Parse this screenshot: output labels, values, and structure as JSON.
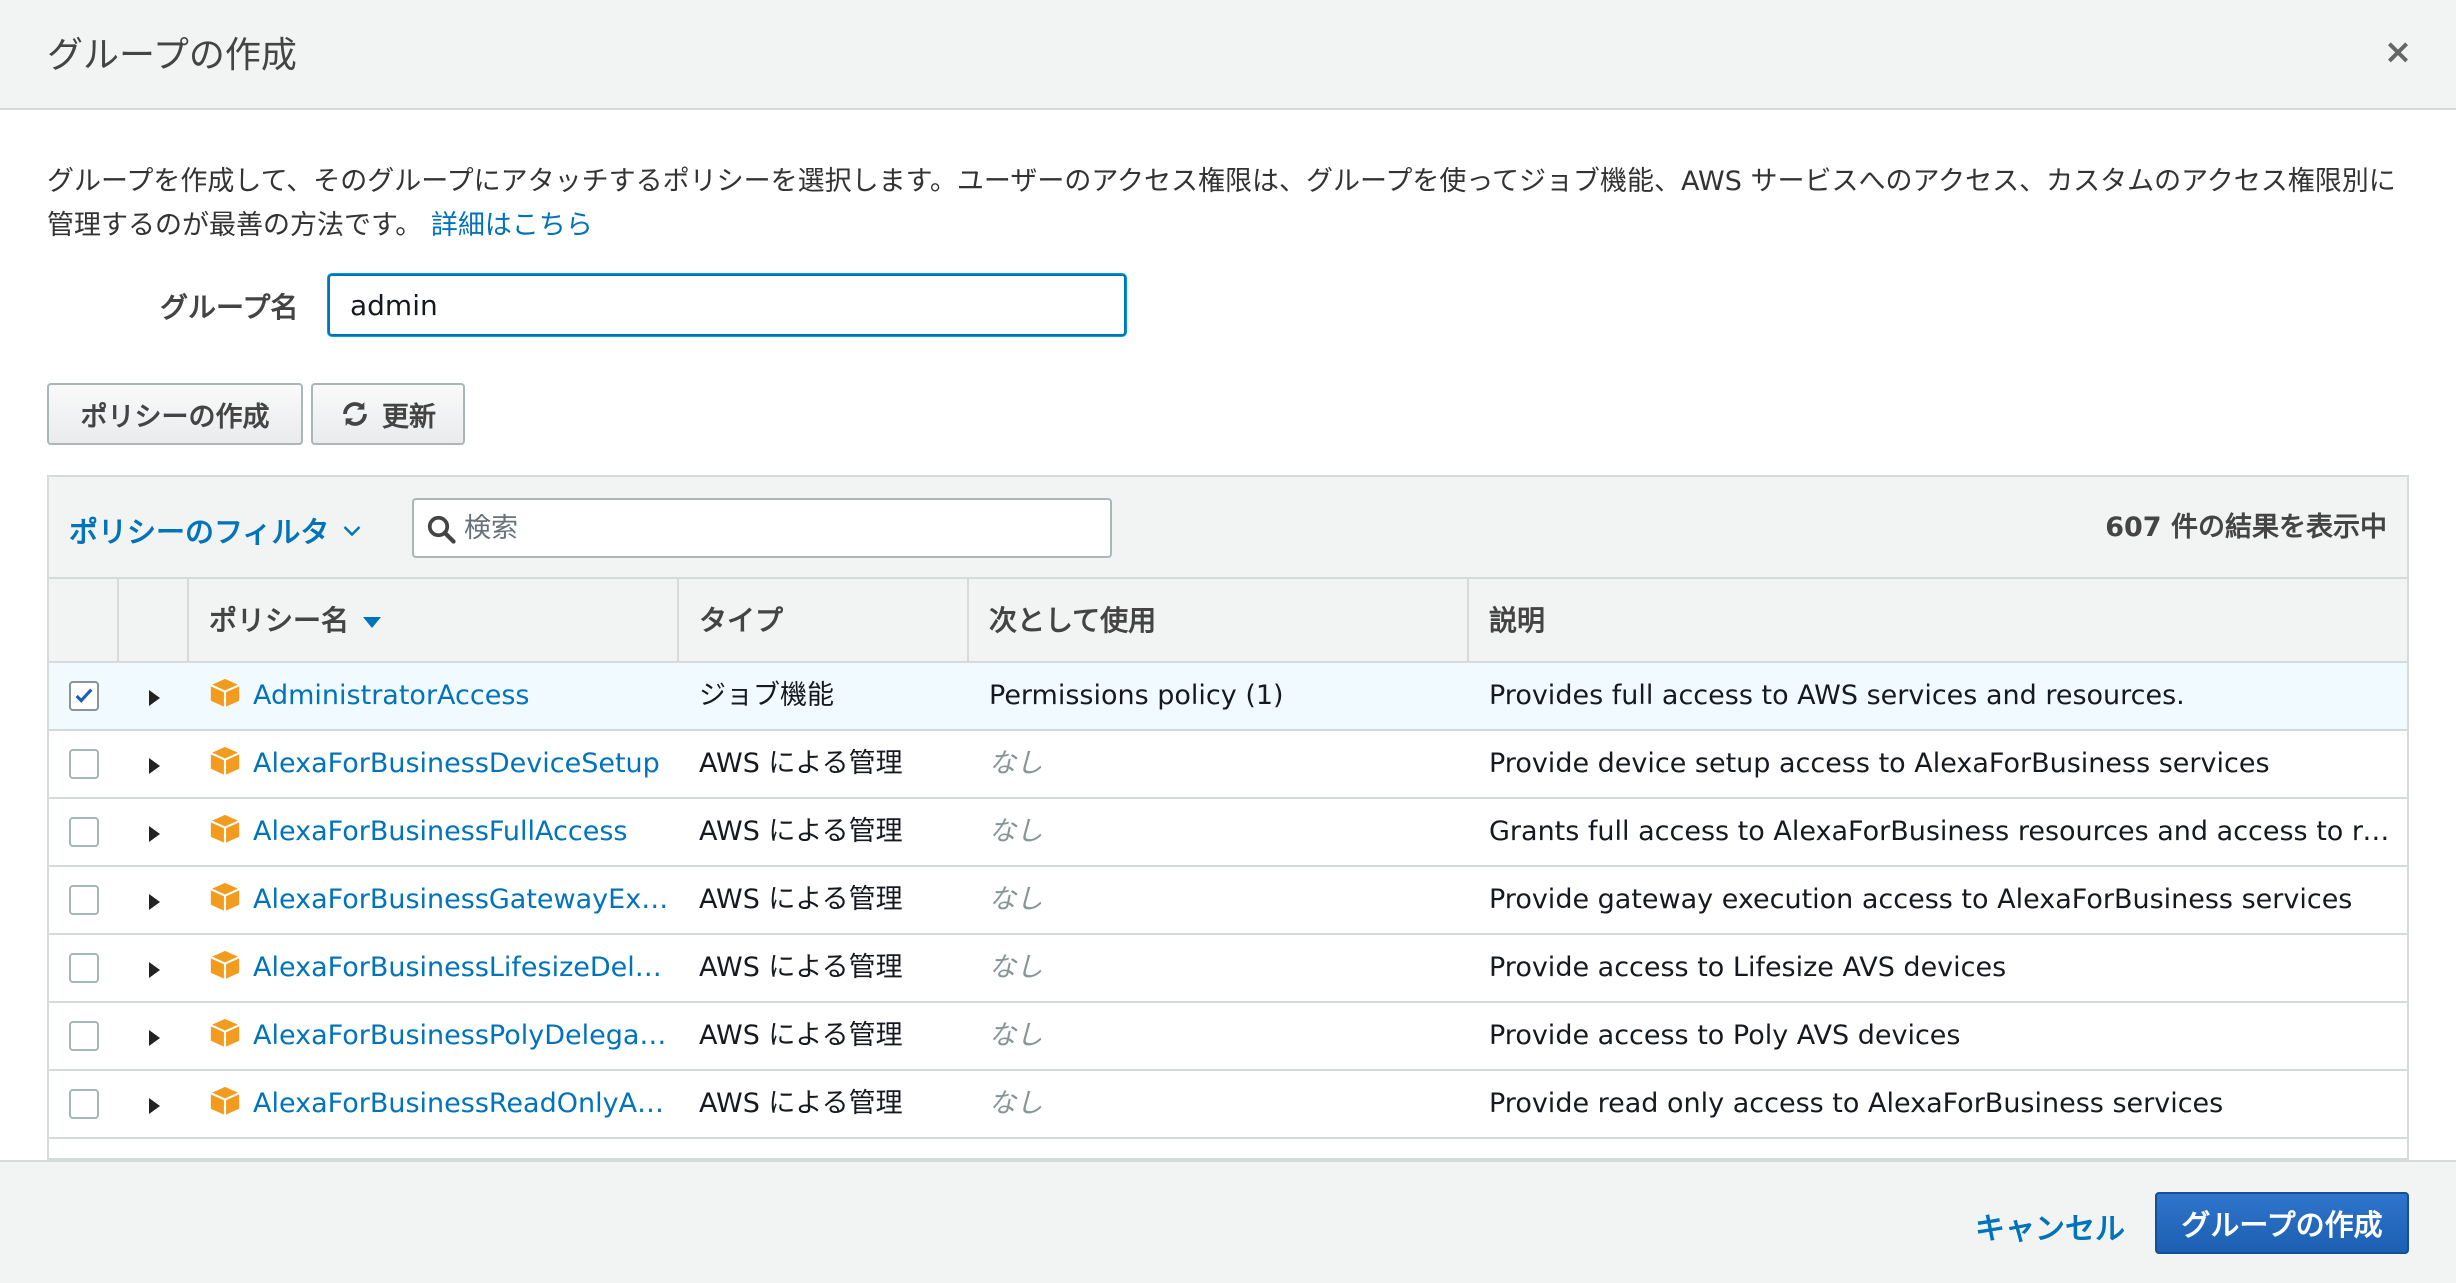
{
  "dialog": {
    "title": "グループの作成",
    "close_label": "×"
  },
  "description": {
    "text": "グループを作成して、そのグループにアタッチするポリシーを選択します。ユーザーのアクセス権限は、グループを使ってジョブ機能、AWS サービスへのアクセス、カスタムのアクセス権限別に管理するのが最善の方法です。",
    "link": "詳細はこちら"
  },
  "group_name": {
    "label": "グループ名",
    "value": "admin"
  },
  "toolbar": {
    "create_policy_label": "ポリシーの作成",
    "refresh_label": "更新"
  },
  "filter": {
    "dropdown_label": "ポリシーのフィルタ",
    "search_placeholder": "検索",
    "result_count": "607 件の結果を表示中"
  },
  "table": {
    "columns": {
      "name": "ポリシー名",
      "type": "タイプ",
      "used_as": "次として使用",
      "description": "説明"
    },
    "rows": [
      {
        "checked": true,
        "name": "AdministratorAccess",
        "type": "ジョブ機能",
        "used_as": "Permissions policy (1)",
        "used_none": false,
        "description": "Provides full access to AWS services and resources."
      },
      {
        "checked": false,
        "name": "AlexaForBusinessDeviceSetup",
        "type": "AWS による管理",
        "used_as": "なし",
        "used_none": true,
        "description": "Provide device setup access to AlexaForBusiness services"
      },
      {
        "checked": false,
        "name": "AlexaForBusinessFullAccess",
        "type": "AWS による管理",
        "used_as": "なし",
        "used_none": true,
        "description": "Grants full access to AlexaForBusiness resources and access to relat…"
      },
      {
        "checked": false,
        "name": "AlexaForBusinessGatewayEx…",
        "type": "AWS による管理",
        "used_as": "なし",
        "used_none": true,
        "description": "Provide gateway execution access to AlexaForBusiness services"
      },
      {
        "checked": false,
        "name": "AlexaForBusinessLifesizeDel…",
        "type": "AWS による管理",
        "used_as": "なし",
        "used_none": true,
        "description": "Provide access to Lifesize AVS devices"
      },
      {
        "checked": false,
        "name": "AlexaForBusinessPolyDelega…",
        "type": "AWS による管理",
        "used_as": "なし",
        "used_none": true,
        "description": "Provide access to Poly AVS devices"
      },
      {
        "checked": false,
        "name": "AlexaForBusinessReadOnlyA…",
        "type": "AWS による管理",
        "used_as": "なし",
        "used_none": true,
        "description": "Provide read only access to AlexaForBusiness services"
      }
    ]
  },
  "footer": {
    "cancel_label": "キャンセル",
    "create_group_label": "グループの作成"
  },
  "colors": {
    "accent": "#0073bb",
    "primary_button": "#1c5fb2",
    "policy_icon": "#f29c1f",
    "selected_row": "#f1faff"
  },
  "icons": {
    "close": "close-icon",
    "refresh": "refresh-icon",
    "search": "search-icon",
    "policy": "policy-box-icon",
    "expand": "expand-triangle-icon"
  }
}
